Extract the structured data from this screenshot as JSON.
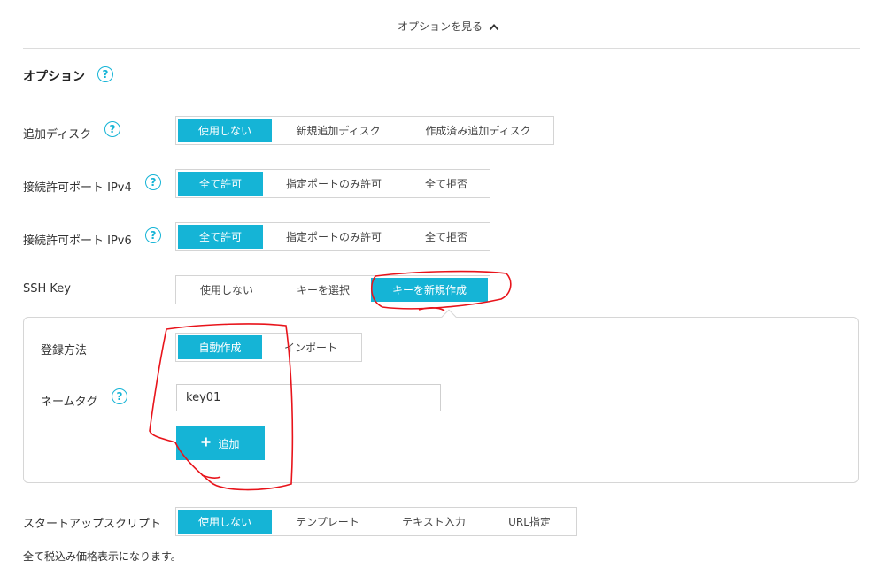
{
  "options_toggle": {
    "label": "オプションを見る",
    "icon": "chevron-up-icon"
  },
  "section": {
    "title": "オプション",
    "help": "?"
  },
  "help_glyph": "?",
  "rows": {
    "disk": {
      "label": "追加ディスク",
      "options": [
        "使用しない",
        "新規追加ディスク",
        "作成済み追加ディスク"
      ],
      "selected": "使用しない"
    },
    "ipv4": {
      "label": "接続許可ポート IPv4",
      "options": [
        "全て許可",
        "指定ポートのみ許可",
        "全て拒否"
      ],
      "selected": "全て許可"
    },
    "ipv6": {
      "label": "接続許可ポート IPv6",
      "options": [
        "全て許可",
        "指定ポートのみ許可",
        "全て拒否"
      ],
      "selected": "全て許可"
    },
    "ssh": {
      "label": "SSH Key",
      "options": [
        "使用しない",
        "キーを選択",
        "キーを新規作成"
      ],
      "selected": "キーを新規作成"
    },
    "startup": {
      "label": "スタートアップスクリプト",
      "options": [
        "使用しない",
        "テンプレート",
        "テキスト入力",
        "URL指定"
      ],
      "selected": "使用しない"
    }
  },
  "ssh_panel": {
    "method": {
      "label": "登録方法",
      "options": [
        "自動作成",
        "インポート"
      ],
      "selected": "自動作成"
    },
    "name_tag": {
      "label": "ネームタグ",
      "value": "key01"
    },
    "add_button": {
      "label": "追加",
      "icon": "plus-icon"
    }
  },
  "footnote": "全て税込み価格表示になります。",
  "colors": {
    "accent": "#15b4d6",
    "annotation": "#e8141b",
    "border": "#d4d4d4"
  }
}
